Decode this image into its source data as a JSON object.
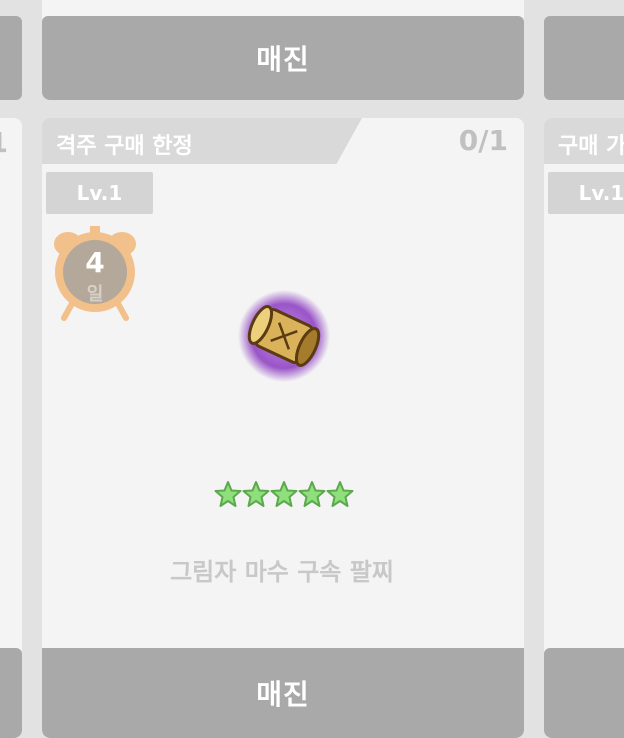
{
  "top_row": {
    "button_label": "매진"
  },
  "left_card": {
    "counter": "1"
  },
  "main_card": {
    "banner": "격주 구매 한정",
    "purchase_count": "0/1",
    "level": "Lv.1",
    "timer": {
      "number": "4",
      "unit": "일"
    },
    "item_icon": "gold-bracelet-icon",
    "stars": 5,
    "item_name": "그림자 마수 구속 팔찌",
    "button_label": "매진"
  },
  "right_card": {
    "banner": "구매 가",
    "level": "Lv.1"
  },
  "colors": {
    "sold_out": "#a9a9a9",
    "star": "#8fe07d",
    "alarm": "#f2c08a"
  }
}
